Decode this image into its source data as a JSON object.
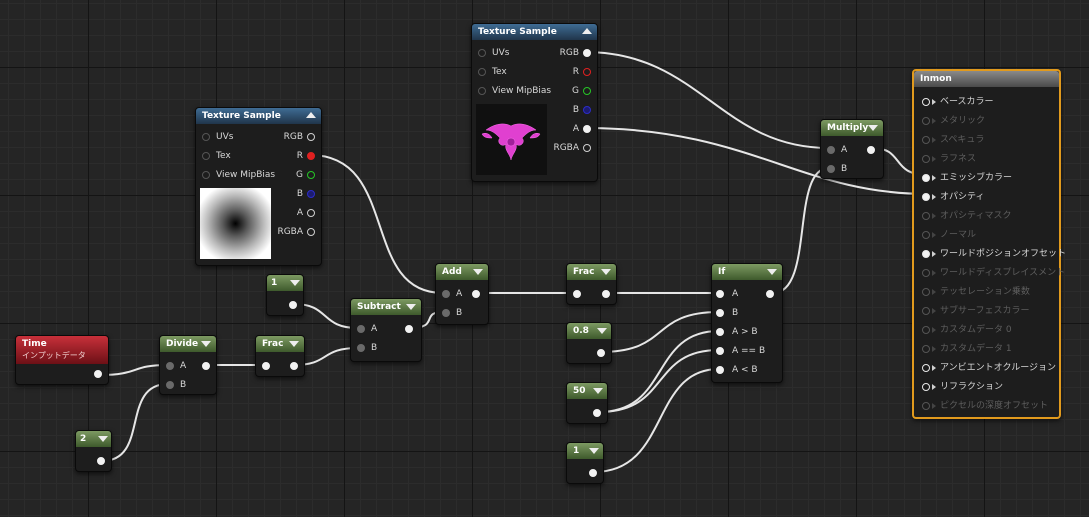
{
  "colors": {
    "accent_main": "#e19a1d",
    "wire": "#e6e6e6",
    "pin_red": "#e02020",
    "pin_green": "#26c626",
    "pin_blue": "#2c2cc8"
  },
  "icons": {
    "collapse_down": "triangle-down",
    "collapse_up": "triangle-up",
    "pin": "circle",
    "exec": "arrow-right"
  },
  "nodes": {
    "texture_sample_1": {
      "title": "Texture Sample",
      "inputs": [
        "UVs",
        "Tex",
        "View MipBias"
      ],
      "outputs": [
        "RGB",
        "R",
        "G",
        "B",
        "A",
        "RGBA"
      ]
    },
    "texture_sample_2": {
      "title": "Texture Sample",
      "inputs": [
        "UVs",
        "Tex",
        "View MipBias"
      ],
      "outputs": [
        "RGB",
        "R",
        "G",
        "B",
        "A",
        "RGBA"
      ]
    },
    "time": {
      "title": "Time",
      "subtitle": "インプットデータ"
    },
    "const_2": {
      "value": "2"
    },
    "const_1": {
      "value": "1"
    },
    "const_08": {
      "value": "0.8"
    },
    "const_50": {
      "value": "50"
    },
    "const_1b": {
      "value": "1"
    },
    "divide": {
      "title": "Divide",
      "inputs": [
        "A",
        "B"
      ]
    },
    "frac_1": {
      "title": "Frac"
    },
    "subtract": {
      "title": "Subtract",
      "inputs": [
        "A",
        "B"
      ]
    },
    "add": {
      "title": "Add",
      "inputs": [
        "A",
        "B"
      ]
    },
    "frac_2": {
      "title": "Frac"
    },
    "if": {
      "title": "If",
      "inputs": [
        "A",
        "B",
        "A > B",
        "A == B",
        "A < B"
      ]
    },
    "multiply": {
      "title": "Multiply",
      "inputs": [
        "A",
        "B"
      ]
    },
    "inmon": {
      "title": "Inmon",
      "pins": [
        {
          "label": "ベースカラー",
          "enabled": true
        },
        {
          "label": "メタリック",
          "enabled": false
        },
        {
          "label": "スペキュラ",
          "enabled": false
        },
        {
          "label": "ラフネス",
          "enabled": false
        },
        {
          "label": "エミッシブカラー",
          "enabled": true
        },
        {
          "label": "オパシティ",
          "enabled": true
        },
        {
          "label": "オパシティマスク",
          "enabled": false
        },
        {
          "label": "ノーマル",
          "enabled": false
        },
        {
          "label": "ワールドポジションオフセット",
          "enabled": true
        },
        {
          "label": "ワールドディスプレイスメント",
          "enabled": false
        },
        {
          "label": "テッセレーション乗数",
          "enabled": false
        },
        {
          "label": "サブサーフェスカラー",
          "enabled": false
        },
        {
          "label": "カスタムデータ 0",
          "enabled": false
        },
        {
          "label": "カスタムデータ 1",
          "enabled": false
        },
        {
          "label": "アンビエントオクルージョン",
          "enabled": true
        },
        {
          "label": "リフラクション",
          "enabled": true
        },
        {
          "label": "ピクセルの深度オフセット",
          "enabled": false
        }
      ]
    }
  }
}
